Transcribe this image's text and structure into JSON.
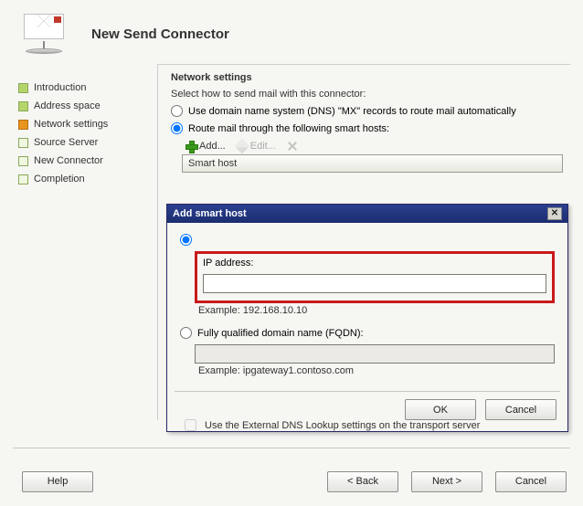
{
  "title": "New Send Connector",
  "nav": {
    "items": [
      {
        "label": "Introduction",
        "state": "done"
      },
      {
        "label": "Address space",
        "state": "done"
      },
      {
        "label": "Network settings",
        "state": "active"
      },
      {
        "label": "Source Server",
        "state": "pending"
      },
      {
        "label": "New Connector",
        "state": "pending"
      },
      {
        "label": "Completion",
        "state": "pending"
      }
    ]
  },
  "content": {
    "section_title": "Network settings",
    "instruction": "Select how to send mail with this connector:",
    "opt_dns": "Use domain name system (DNS) \"MX\" records to route mail automatically",
    "opt_smart": "Route mail through the following smart hosts:",
    "toolbar": {
      "add": "Add...",
      "edit": "Edit...",
      "delete": ""
    },
    "grid_header": "Smart host",
    "external_dns": "Use the External DNS Lookup settings on the transport server"
  },
  "dialog": {
    "title": "Add smart host",
    "opt_ip": "IP address:",
    "ip_value": "",
    "ip_example": "Example: 192.168.10.10",
    "opt_fqdn": "Fully qualified domain name (FQDN):",
    "fqdn_value": "",
    "fqdn_example": "Example: ipgateway1.contoso.com",
    "btn_ok": "OK",
    "btn_cancel": "Cancel"
  },
  "buttons": {
    "help": "Help",
    "back": "< Back",
    "next": "Next >",
    "cancel": "Cancel"
  }
}
